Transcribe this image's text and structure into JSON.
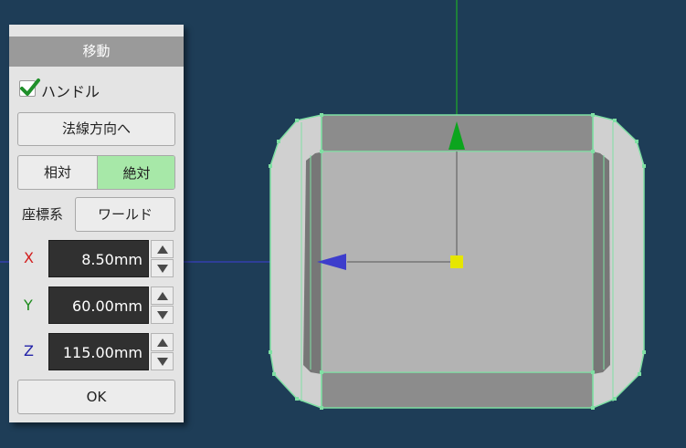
{
  "panel": {
    "title": "移動",
    "handle": {
      "label": "ハンドル",
      "checked": true
    },
    "normal_button": "法線方向へ",
    "mode": {
      "relative": "相対",
      "absolute": "絶対",
      "selected": "absolute"
    },
    "coordinate": {
      "label": "座標系",
      "value": "ワールド"
    },
    "fields": [
      {
        "axis": "X",
        "value": "8.50mm",
        "color": "#d21c1c"
      },
      {
        "axis": "Y",
        "value": "60.00mm",
        "color": "#1a8a1a"
      },
      {
        "axis": "Z",
        "value": "115.00mm",
        "color": "#2323a8"
      }
    ],
    "ok_button": "OK"
  },
  "viewport": {
    "background": "#1e3d57",
    "object_color": "#b3b3b3",
    "edge_color": "#7fe0a3",
    "gizmo": {
      "y_arrow_color": "#0ca51e",
      "x_arrow_color": "#3d3dcc",
      "center_color": "#e6e600"
    }
  }
}
